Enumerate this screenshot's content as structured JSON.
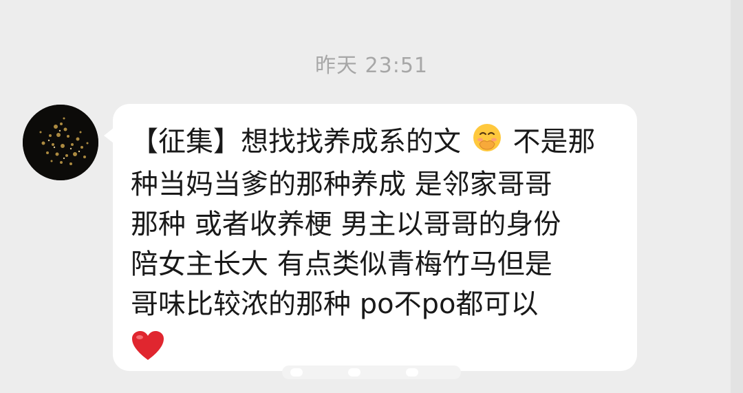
{
  "chat": {
    "timestamp": "昨天 23:51",
    "message": {
      "lines": [
        "【征集】想找找养成系的文",
        "不是那",
        "种当妈当爹的那种养成 是邻家哥哥",
        "那种 或者收养梗 男主以哥哥的身份",
        "陪女主长大 有点类似青梅竹马但是",
        "哥味比较浓的那种 po不po都可以"
      ],
      "emoji_1": "face-with-hand-over-mouth-emoji",
      "emoji_2": "red-heart-emoji"
    }
  },
  "colors": {
    "background": "#ededed",
    "bubble": "#ffffff",
    "timestamp_text": "#a7a7a7",
    "message_text": "#191919",
    "heart": "#e0262f",
    "emoji_face": "#ffc83d"
  }
}
